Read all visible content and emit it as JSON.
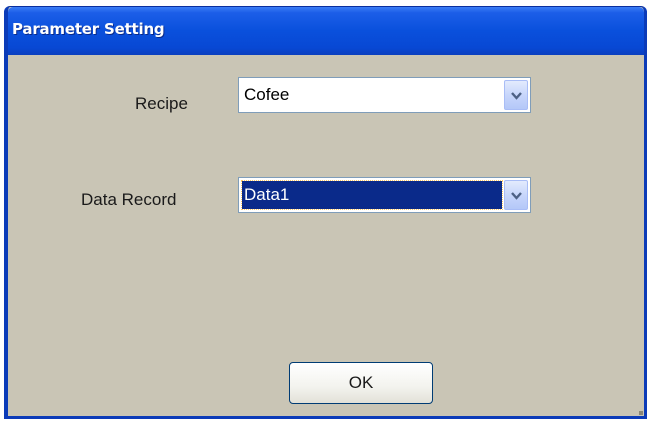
{
  "window": {
    "title": "Parameter Setting"
  },
  "form": {
    "recipe_label": "Recipe",
    "recipe_value": "Cofee",
    "data_record_label": "Data Record",
    "data_record_value": "Data1"
  },
  "buttons": {
    "ok_label": "OK"
  },
  "colors": {
    "titlebar": "#0a50dc",
    "window_frame": "#0b3bb8",
    "dialog_background": "#c9c5b5",
    "selection": "#0a2a8a"
  },
  "icons": {
    "dropdown": "chevron-down-icon"
  }
}
